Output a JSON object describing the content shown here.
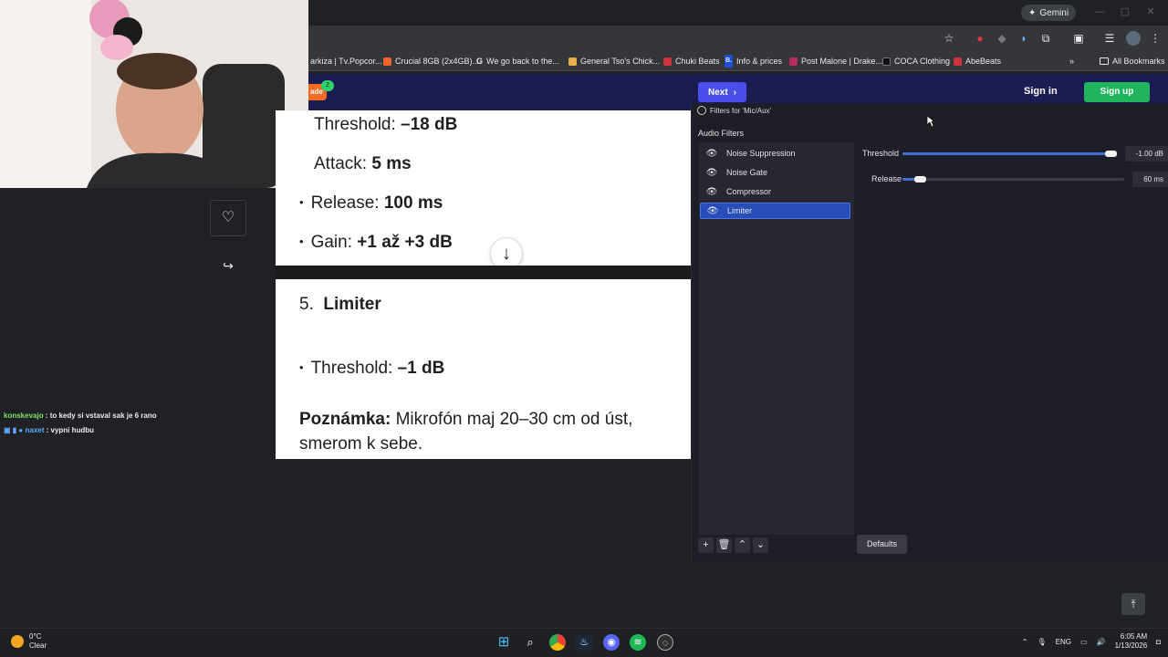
{
  "browser": {
    "gemini_label": "Gemini",
    "bookmarks": [
      {
        "label": "arkiza | Tv.Popcor...",
        "color": "#6b6b6b"
      },
      {
        "label": "Crucial 8GB (2x4GB)...",
        "color": "#f0642c"
      },
      {
        "label": "We go back to the...",
        "color": "#ffffff",
        "glyph": "G"
      },
      {
        "label": "General Tso's Chick...",
        "color": "#e8b04a"
      },
      {
        "label": "Chuki Beats",
        "color": "#d0333b"
      },
      {
        "label": "Info & prices",
        "color": "#1c4fd6",
        "glyph": "B."
      },
      {
        "label": "Post Malone | Drake...",
        "color": "#b62b5a"
      },
      {
        "label": "COCA Clothing",
        "color": "#111111"
      },
      {
        "label": "AbeBeats",
        "color": "#d0333b"
      }
    ],
    "all_bookmarks_label": "All Bookmarks"
  },
  "site": {
    "badge_text": "ade",
    "badge_count": "2",
    "next_label": "Next",
    "signin_label": "Sign in",
    "signup_label": "Sign up"
  },
  "chat": [
    {
      "user": "konskevajo",
      "message": " : to kedy si vstaval sak je 6 rano"
    },
    {
      "user": "naxet",
      "message": " : vypni hudbu"
    }
  ],
  "doc": {
    "section1": {
      "threshold_label": "Threshold: ",
      "threshold_value": "–18 dB",
      "attack_label": "Attack: ",
      "attack_value": "5 ms",
      "release_label": "Release: ",
      "release_value": "100 ms",
      "gain_label": "Gain: ",
      "gain_value": "+1 až +3 dB"
    },
    "section2": {
      "number": "5.",
      "heading": "Limiter",
      "threshold_label": "Threshold: ",
      "threshold_value": "–1 dB",
      "note_label": "Poznámka:",
      "note_text_line1": " Mikrofón maj 20–30 cm od úst,",
      "note_text_line2": "smerom k sebe."
    }
  },
  "obs": {
    "window_title": "Filters for 'Mic/Aux'",
    "audio_filters_label": "Audio Filters",
    "filters": [
      {
        "label": "Noise Suppression",
        "selected": false
      },
      {
        "label": "Noise Gate",
        "selected": false
      },
      {
        "label": "Compressor",
        "selected": false
      },
      {
        "label": "Limiter",
        "selected": true
      }
    ],
    "threshold": {
      "label": "Threshold",
      "value": "-1.00 dB",
      "fraction": 0.98
    },
    "release": {
      "label": "Release",
      "value": "60 ms",
      "fraction": 0.08
    },
    "defaults_label": "Defaults"
  },
  "taskbar": {
    "weather_temp": "0°C",
    "weather_desc": "Clear",
    "language": "ENG",
    "time": "6:05 AM",
    "date": "1/13/2026"
  }
}
